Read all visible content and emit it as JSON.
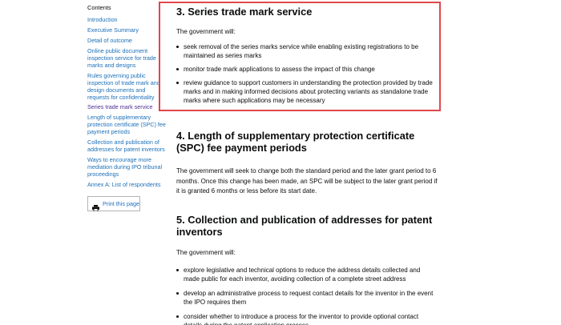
{
  "sidebar": {
    "heading": "Contents",
    "items": [
      {
        "label": "Introduction"
      },
      {
        "label": "Executive Summary"
      },
      {
        "label": "Detail of outcome"
      },
      {
        "label": "Online public document inspection service for trade marks and designs"
      },
      {
        "label": "Rules governing public inspection of trade mark and design documents and requests for confidentiality"
      },
      {
        "label": "Series trade mark service"
      },
      {
        "label": "Length of supplementary protection certificate (SPC) fee payment periods"
      },
      {
        "label": "Collection and publication of addresses for patent inventors"
      },
      {
        "label": "Ways to encourage more mediation during IPO tribunal proceedings"
      },
      {
        "label": "Annex A: List of respondents"
      }
    ],
    "print_label": "Print this page"
  },
  "section3": {
    "title": "3. Series trade mark service",
    "intro": "The government will:",
    "bullets": [
      "seek removal of the series marks service while enabling existing registrations to be maintained as series marks",
      "monitor trade mark applications to assess the impact of this change",
      "review guidance to support customers in understanding the protection provided by trade marks and in making informed decisions about protecting variants as standalone trade marks where such applications may be necessary"
    ]
  },
  "section4": {
    "title": "4. Length of supplementary protection certificate (SPC) fee payment periods",
    "body": "The government will seek to change both the standard period and the later grant period to 6 months. Once this change has been made, an SPC will be subject to the later grant period if it is granted 6 months or less before its start date."
  },
  "section5": {
    "title": "5. Collection and publication of addresses for patent inventors",
    "intro": "The government will:",
    "bullets": [
      "explore legislative and technical options to reduce the address details collected and made public for each inventor, avoiding collection of a complete street address",
      "develop an administrative process to request contact details for the inventor in the event the IPO requires them",
      "consider whether to introduce a process for the inventor to provide optional contact details during the patent application process"
    ]
  },
  "colors": {
    "link": "#1d70b8",
    "visited_link": "#4c2c92",
    "highlight_border": "#e0474c",
    "text": "#0b0c0c"
  }
}
